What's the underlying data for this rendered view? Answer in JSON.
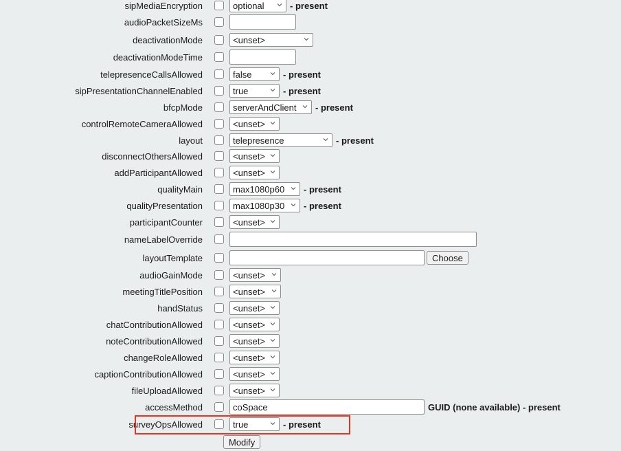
{
  "fields": [
    {
      "label": "sipMediaEncryption",
      "type": "select",
      "value": "optional",
      "present": "- present"
    },
    {
      "label": "audioPacketSizeMs",
      "type": "text",
      "value": ""
    },
    {
      "label": "deactivationMode",
      "type": "select",
      "value": "<unset>"
    },
    {
      "label": "deactivationModeTime",
      "type": "text",
      "value": ""
    },
    {
      "label": "telepresenceCallsAllowed",
      "type": "select",
      "value": "false",
      "present": "- present"
    },
    {
      "label": "sipPresentationChannelEnabled",
      "type": "select",
      "value": "true",
      "present": "- present"
    },
    {
      "label": "bfcpMode",
      "type": "select",
      "value": "serverAndClient",
      "present": "- present"
    },
    {
      "label": "controlRemoteCameraAllowed",
      "type": "select",
      "value": "<unset>"
    },
    {
      "label": "layout",
      "type": "select",
      "value": "telepresence",
      "present": "- present"
    },
    {
      "label": "disconnectOthersAllowed",
      "type": "select",
      "value": "<unset>"
    },
    {
      "label": "addParticipantAllowed",
      "type": "select",
      "value": "<unset>"
    },
    {
      "label": "qualityMain",
      "type": "select",
      "value": "max1080p60",
      "present": "- present"
    },
    {
      "label": "qualityPresentation",
      "type": "select",
      "value": "max1080p30",
      "present": "- present"
    },
    {
      "label": "participantCounter",
      "type": "select",
      "value": "<unset>"
    },
    {
      "label": "nameLabelOverride",
      "type": "text",
      "value": ""
    },
    {
      "label": "layoutTemplate",
      "type": "text",
      "value": "",
      "button": "Choose"
    },
    {
      "label": "audioGainMode",
      "type": "select",
      "value": "<unset>"
    },
    {
      "label": "meetingTitlePosition",
      "type": "select",
      "value": "<unset>"
    },
    {
      "label": "handStatus",
      "type": "select",
      "value": "<unset>"
    },
    {
      "label": "chatContributionAllowed",
      "type": "select",
      "value": "<unset>"
    },
    {
      "label": "noteContributionAllowed",
      "type": "select",
      "value": "<unset>"
    },
    {
      "label": "changeRoleAllowed",
      "type": "select",
      "value": "<unset>"
    },
    {
      "label": "captionContributionAllowed",
      "type": "select",
      "value": "<unset>"
    },
    {
      "label": "fileUploadAllowed",
      "type": "select",
      "value": "<unset>"
    },
    {
      "label": "accessMethod",
      "type": "text",
      "value": "coSpace",
      "present": "GUID (none available) - present"
    },
    {
      "label": "surveyOpsAllowed",
      "type": "select",
      "value": "true",
      "present": "- present"
    }
  ],
  "modify_button": "Modify",
  "highlight_color": "#e8321f"
}
